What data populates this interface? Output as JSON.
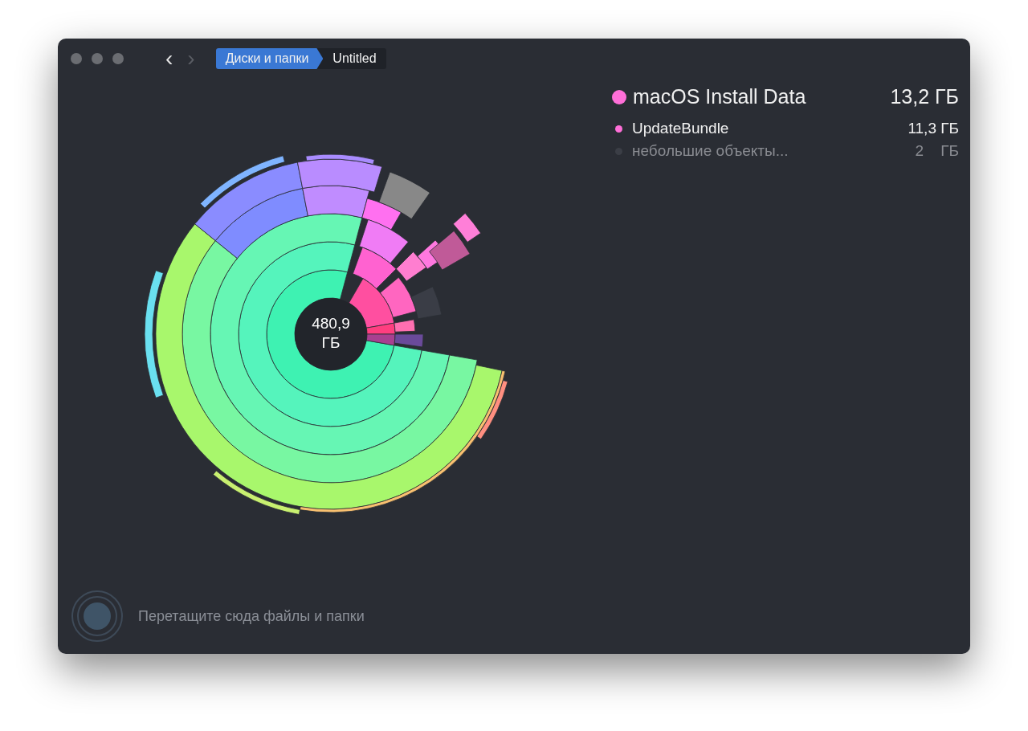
{
  "toolbar": {
    "back": {
      "label": "‹",
      "disabled": false
    },
    "forward": {
      "label": "›",
      "disabled": true
    },
    "breadcrumbs": [
      {
        "label": "Диски и папки",
        "selected": true
      },
      {
        "label": "Untitled",
        "selected": false
      }
    ]
  },
  "chart": {
    "center_label": "480,9 ГБ"
  },
  "legend": {
    "header": {
      "name": "macOS Install Data",
      "size": "13,2 ГБ",
      "color": "#ff6fd8"
    },
    "items": [
      {
        "name": "UpdateBundle",
        "size": "11,3 ГБ",
        "color": "#ff6fd8",
        "dimmed": false
      },
      {
        "name": "небольшие объекты...",
        "size": "2    ГБ",
        "color": "#3b3e46",
        "dimmed": true
      }
    ]
  },
  "drop_zone": {
    "hint": "Перетащите сюда файлы и папки"
  }
}
